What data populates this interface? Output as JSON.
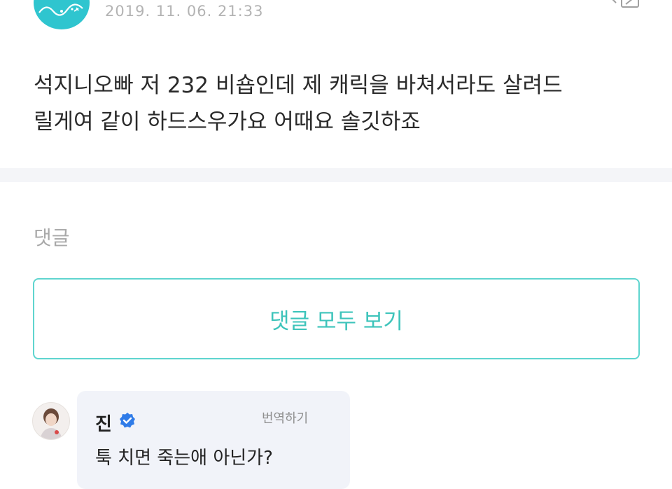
{
  "post": {
    "timestamp": "2019. 11. 06. 21:33",
    "body_line1": "석지니오빠 저 232 비숍인데 제 캐릭을 바쳐서라도 살려드",
    "body_line2": "릴게여 같이 하드스우가요 어때요 솔깃하죠"
  },
  "comments": {
    "section_title": "댓글",
    "view_all_label": "댓글 모두 보기",
    "items": [
      {
        "author": "진",
        "translate_label": "번역하기",
        "text": "툭 치면 죽는애 아닌가?"
      }
    ]
  },
  "colors": {
    "accent": "#3ec4bb",
    "avatar_bg": "#2fc5cf",
    "bubble_bg": "#f1f3f9",
    "verified": "#2f7be8"
  },
  "icons": {
    "share": "share-icon",
    "verified": "verified-badge-icon"
  }
}
